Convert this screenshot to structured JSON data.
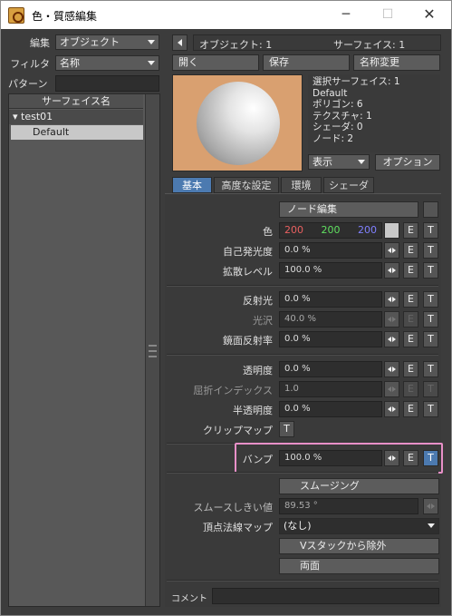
{
  "window": {
    "title": "色・質感編集",
    "min": "─",
    "max": "☐",
    "close": "✕"
  },
  "left": {
    "edit_label": "編集",
    "edit_value": "オブジェクト",
    "filter_label": "フィルタ",
    "filter_value": "名称",
    "pattern_label": "パターン",
    "list_header": "サーフェイス名",
    "tree": {
      "parent": "test01",
      "child": "Default"
    }
  },
  "top": {
    "object_label": "オブジェクト: 1",
    "surface_label": "サーフェイス: 1",
    "open": "開く",
    "save": "保存",
    "rename": "名称変更"
  },
  "info": {
    "lines": [
      "選択サーフェイス: 1",
      "Default",
      "ポリゴン: 6",
      "テクスチャ: 1",
      "シェーダ: 0",
      "ノード: 2"
    ],
    "display": "表示",
    "options": "オプション"
  },
  "tabs": [
    "基本",
    "高度な設定",
    "環境",
    "シェーダ"
  ],
  "basic": {
    "node_edit": "ノード編集",
    "color_label": "色",
    "color_r": "200",
    "color_g": "200",
    "color_b": "200",
    "luminosity_label": "自己発光度",
    "luminosity": "0.0 %",
    "diffuse_label": "拡散レベル",
    "diffuse": "100.0 %",
    "specular_label": "反射光",
    "specular": "0.0 %",
    "gloss_label": "光沢",
    "gloss": "40.0 %",
    "reflection_label": "鏡面反射率",
    "reflection": "0.0 %",
    "transparency_label": "透明度",
    "transparency": "0.0 %",
    "refraction_label": "屈折インデックス",
    "refraction": "1.0",
    "translucency_label": "半透明度",
    "translucency": "0.0 %",
    "clipmap_label": "クリップマップ",
    "bump_label": "バンプ",
    "bump": "100.0 %",
    "smoothing": "スムージング",
    "smooth_threshold_label": "スムースしきい値",
    "smooth_threshold": "89.53 °",
    "vertex_normal_label": "頂点法線マップ",
    "vertex_normal": "(なし)",
    "exclude_vstack": "Vスタックから除外",
    "double_sided": "両面",
    "comment_label": "コメント",
    "btn_e": "E",
    "btn_t": "T"
  }
}
